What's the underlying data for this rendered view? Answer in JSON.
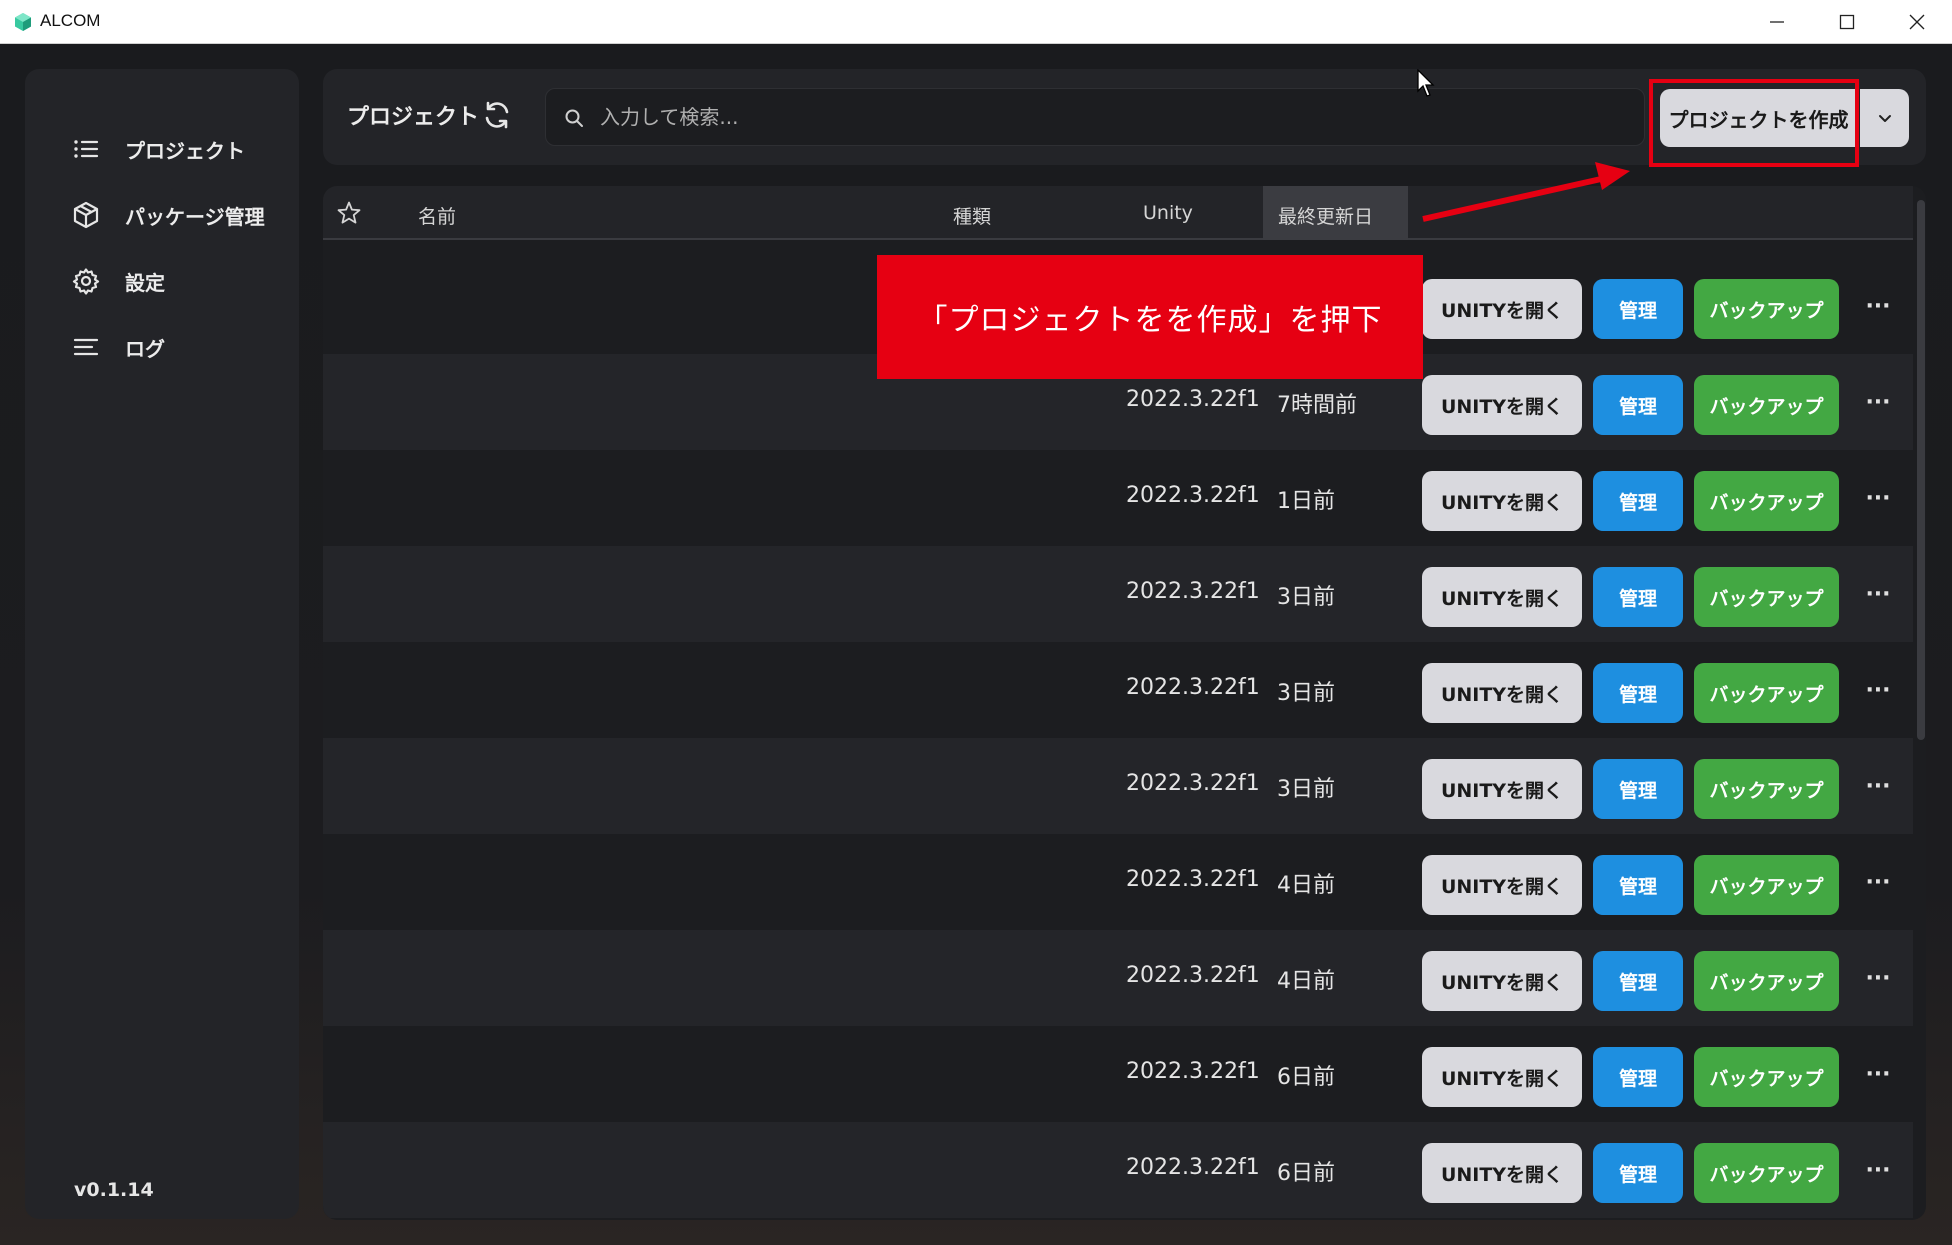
{
  "window": {
    "title": "ALCOM",
    "icon": "alcom-cube-icon",
    "controls": [
      "minimize-icon",
      "maximize-icon",
      "close-icon"
    ]
  },
  "sidebar": {
    "items": [
      {
        "label": "プロジェクト",
        "icon": "list-icon"
      },
      {
        "label": "パッケージ管理",
        "icon": "package-icon"
      },
      {
        "label": "設定",
        "icon": "gear-icon"
      },
      {
        "label": "ログ",
        "icon": "log-lines-icon"
      }
    ],
    "version": "v0.1.14"
  },
  "header": {
    "title": "プロジェクト",
    "search_placeholder": "入力して検索...",
    "create_button": "プロジェクトを作成"
  },
  "table": {
    "columns": [
      "名前",
      "種類",
      "Unity",
      "最終更新日"
    ],
    "rows": [
      {
        "unity": "",
        "last_modified": ""
      },
      {
        "unity": "2022.3.22f1",
        "last_modified": "7時間前"
      },
      {
        "unity": "2022.3.22f1",
        "last_modified": "1日前"
      },
      {
        "unity": "2022.3.22f1",
        "last_modified": "3日前"
      },
      {
        "unity": "2022.3.22f1",
        "last_modified": "3日前"
      },
      {
        "unity": "2022.3.22f1",
        "last_modified": "3日前"
      },
      {
        "unity": "2022.3.22f1",
        "last_modified": "4日前"
      },
      {
        "unity": "2022.3.22f1",
        "last_modified": "4日前"
      },
      {
        "unity": "2022.3.22f1",
        "last_modified": "6日前"
      },
      {
        "unity": "2022.3.22f1",
        "last_modified": "6日前"
      }
    ],
    "actions": {
      "open_unity": "UNITYを開く",
      "manage": "管理",
      "backup": "バックアップ",
      "more": "···"
    }
  },
  "annotation": {
    "callout_text": "「プロジェクトをを作成」を押下",
    "color": "#e60012"
  },
  "colors": {
    "manage_blue": "#1e8fe0",
    "backup_green": "#43a843",
    "button_gray": "#d9d9de"
  }
}
